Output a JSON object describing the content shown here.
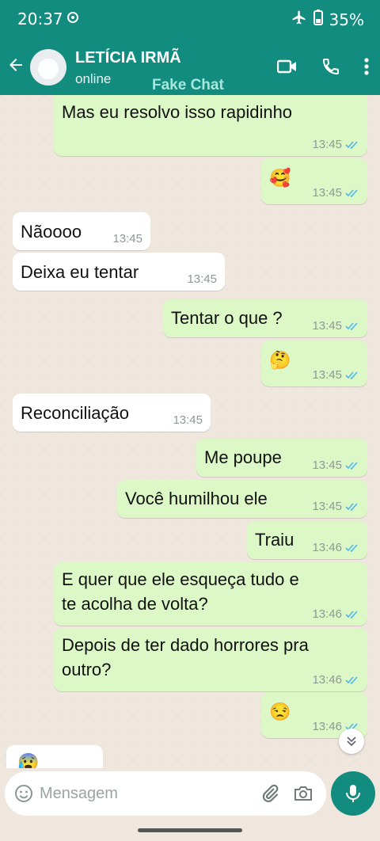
{
  "status_bar": {
    "time": "20:37",
    "battery": "35%"
  },
  "header": {
    "name": "LETÍCIA IRMÃ",
    "status": "online",
    "watermark": "Fake Chat"
  },
  "messages": [
    {
      "dir": "out",
      "text": "Mas eu resolvo isso rapidinho",
      "time": "13:45"
    },
    {
      "dir": "out",
      "text": "🥰",
      "time": "13:45"
    },
    {
      "dir": "in",
      "text": "Nãoooo",
      "time": "13:45"
    },
    {
      "dir": "in",
      "text": "Deixa eu tentar",
      "time": "13:45"
    },
    {
      "dir": "out",
      "text": "Tentar o que ?",
      "time": "13:45"
    },
    {
      "dir": "out",
      "text": "🤔",
      "time": "13:45"
    },
    {
      "dir": "in",
      "text": "Reconciliação",
      "time": "13:45"
    },
    {
      "dir": "out",
      "text": "Me poupe",
      "time": "13:45"
    },
    {
      "dir": "out",
      "text": "Você humilhou ele",
      "time": "13:45"
    },
    {
      "dir": "out",
      "text": "Traiu",
      "time": "13:46"
    },
    {
      "dir": "out",
      "text": "E quer que ele esqueça tudo e\nte acolha de volta?",
      "time": "13:46"
    },
    {
      "dir": "out",
      "text": "Depois de ter dado horrores pra\noutro?",
      "time": "13:46"
    },
    {
      "dir": "out",
      "text": "😒",
      "time": "13:46"
    },
    {
      "dir": "in",
      "text": "😰",
      "time": ""
    }
  ],
  "composer": {
    "placeholder": "Mensagem"
  },
  "colors": {
    "header": "#128c7e",
    "outgoing": "#dcf8c6",
    "incoming": "#ffffff",
    "tick": "#4fb6ec"
  }
}
